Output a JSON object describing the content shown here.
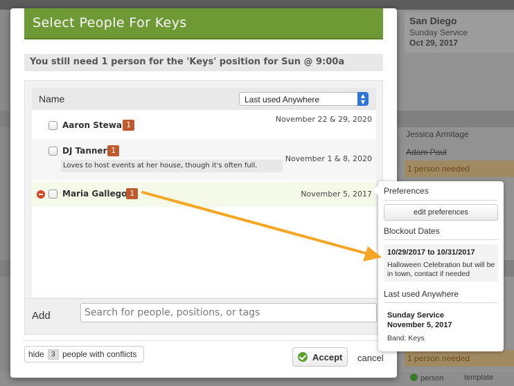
{
  "background": {
    "plan_title": "San Diego",
    "plan_service": "Sunday Service",
    "plan_date": "Oct 29, 2017",
    "people": [
      "Jessica Armitage",
      "Adam Paul"
    ],
    "needed_label": "1 person needed",
    "footer_buttons": [
      "person",
      "template"
    ]
  },
  "modal": {
    "title": "Select People For Keys",
    "need_message": "You still need 1 person for the 'Keys' position for Sun @ 9:00a",
    "list": {
      "column_header": "Name",
      "sort_select_value": "Last used Anywhere",
      "rows": [
        {
          "name": "Aaron Stewart",
          "count": "1",
          "date": "November 22 & 29, 2020",
          "note": ""
        },
        {
          "name": "DJ Tanner",
          "count": "1",
          "date": "November 1 & 8, 2020",
          "note": "Loves to host events at her house, though it's often full."
        },
        {
          "name": "Maria Gallegos",
          "count": "1",
          "date": "November 5, 2017",
          "note": ""
        }
      ]
    },
    "add": {
      "label": "Add",
      "placeholder": "Search for people, positions, or tags"
    },
    "footer": {
      "hide_prefix": "hide",
      "hide_count": "3",
      "hide_suffix": "people with conflicts",
      "accept_label": "Accept",
      "cancel_label": "cancel"
    }
  },
  "popover": {
    "preferences_heading": "Preferences",
    "edit_preferences_label": "edit preferences",
    "blockout_heading": "Blockout Dates",
    "blockout_range": "10/29/2017 to 10/31/2017",
    "blockout_note": "Halloween Celebration but will be in town, contact if needed",
    "last_used_heading": "Last used Anywhere",
    "last_used_service": "Sunday Service",
    "last_used_date": "November 5, 2017",
    "last_used_band": "Band: Keys"
  },
  "colors": {
    "header_green": "#6e9a36",
    "badge_orange": "#bf5a2e",
    "annotation_arrow": "#f5a623",
    "remove_red": "#d8462a"
  }
}
